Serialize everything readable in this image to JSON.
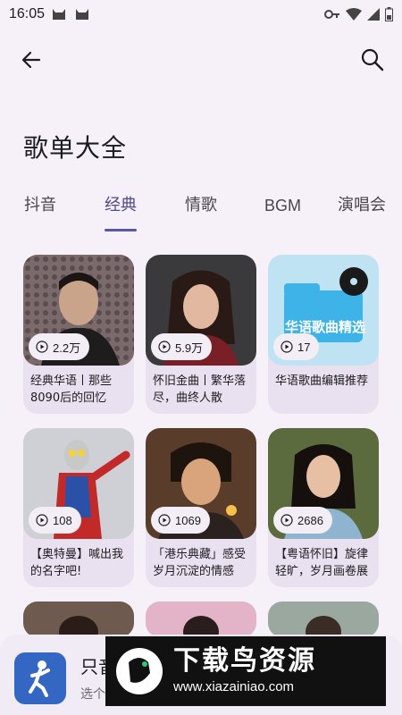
{
  "status_bar": {
    "time": "16:05"
  },
  "page": {
    "title": "歌单大全"
  },
  "tabs": [
    {
      "label": "抖音",
      "active": false
    },
    {
      "label": "经典",
      "active": true
    },
    {
      "label": "情歌",
      "active": false
    },
    {
      "label": "BGM",
      "active": false
    },
    {
      "label": "演唱会",
      "active": false
    }
  ],
  "playlists": [
    {
      "plays": "2.2万",
      "title": "经典华语丨那些8090后的回忆"
    },
    {
      "plays": "5.9万",
      "title": "怀旧金曲丨繁华落尽，曲终人散"
    },
    {
      "plays": "17",
      "title": "华语歌曲编辑推荐",
      "cover_text": "华语歌曲精选"
    },
    {
      "plays": "108",
      "title": "【奥特曼】喊出我的名字吧!"
    },
    {
      "plays": "1069",
      "title": "「港乐典藏」感受岁月沉淀的情感"
    },
    {
      "plays": "2686",
      "title": "【粤语怀旧】旋律轻旷，岁月画卷展"
    }
  ],
  "player": {
    "title": "只音",
    "subtitle": "选个"
  },
  "watermark": {
    "title": "下载鸟资源",
    "url": "www.xiazainiao.com"
  },
  "colors": {
    "accent": "#5b55a3",
    "background": "#f6f1f8",
    "card": "#e9e1ef"
  }
}
